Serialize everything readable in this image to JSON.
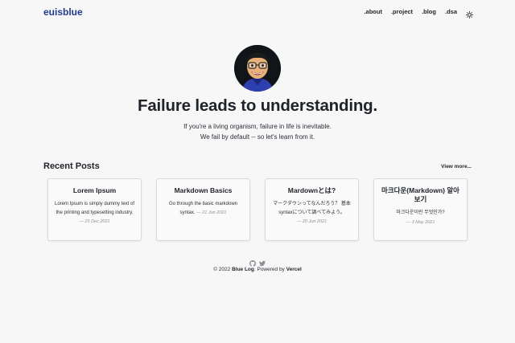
{
  "header": {
    "logo": "euisblue",
    "nav": [
      ".about",
      ".project",
      ".blog",
      ".dsa"
    ],
    "theme_icon": "sun-icon"
  },
  "hero": {
    "headline": "Failure leads to understanding.",
    "line1": "If you're a living organism, failure in life is inevitable.",
    "line2": "We fail by default -- so let's learn from it."
  },
  "recent": {
    "title": "Recent Posts",
    "view_more": "View more..."
  },
  "posts": [
    {
      "title": "Lorem Ipsum",
      "desc": "Lorem Ipsum is simply dummy text of the printing and typesetting industry.",
      "date": "— 25 Dec 2021"
    },
    {
      "title": "Markdown Basics",
      "desc": "Go through the basic markdown syntax.",
      "date": "— 21 Jun 2021"
    },
    {
      "title": "Mardownとは?",
      "desc": "マークダウンってなんだろう？ 基本syntaxについて調べてみよう。",
      "date": "— 20 Jun 2021"
    },
    {
      "title": "마크다운(Markdown) 알아보기",
      "desc": "마크다운이란 무엇인가?",
      "date": "— 3 May 2021"
    }
  ],
  "footer": {
    "icons": [
      "github-icon",
      "twitter-icon"
    ],
    "prefix": "© 2022",
    "brand": "Blue Log",
    "middle": ". Powered by",
    "powered": "Vercel"
  },
  "colors": {
    "background": "#f7f7f8",
    "logo": "#1e3a8a",
    "text": "#1f2329"
  }
}
